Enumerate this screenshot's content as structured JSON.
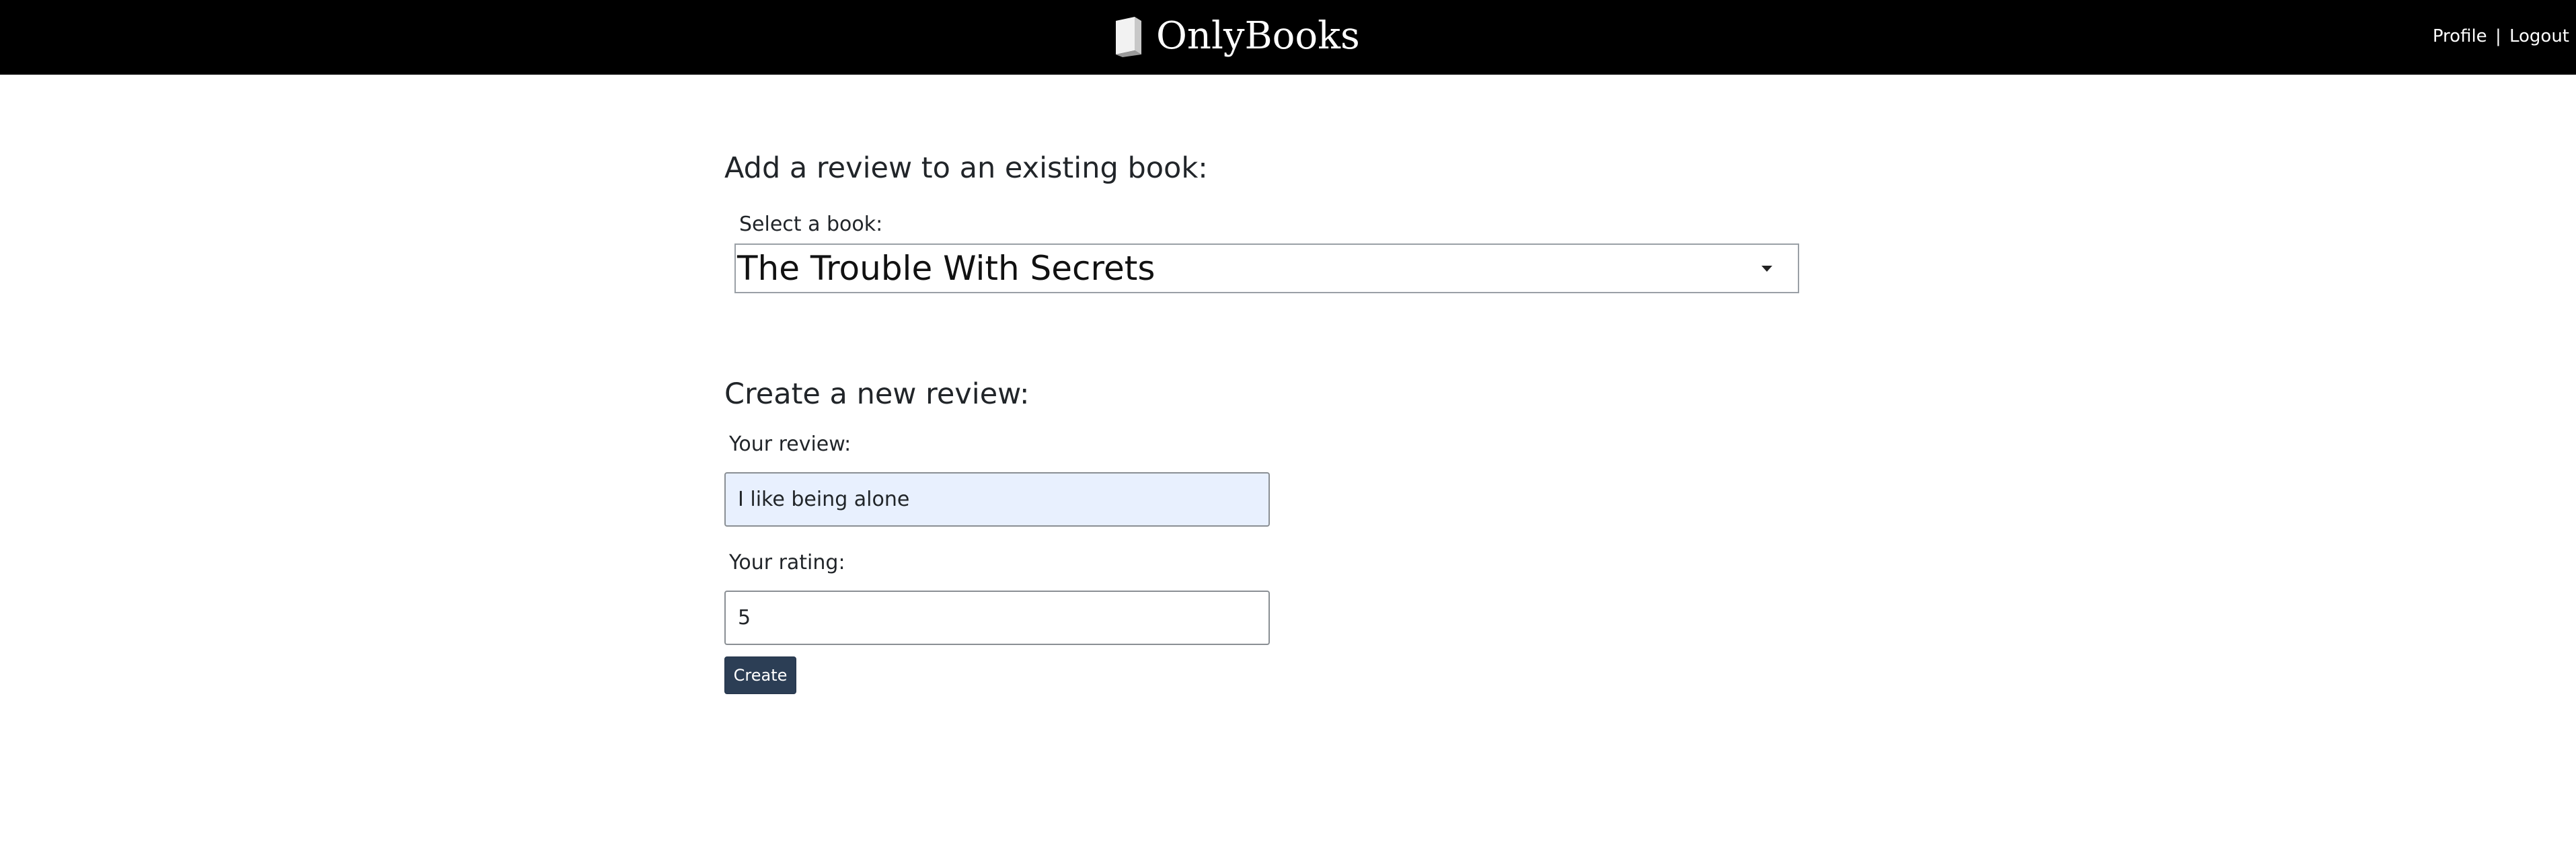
{
  "navbar": {
    "brand": "OnlyBooks",
    "brand_icon": "book-icon",
    "profile_link": "Profile",
    "separator": "|",
    "logout_link": "Logout"
  },
  "existing_section": {
    "title": "Add a review to an existing book:",
    "select_label": "Select a book:",
    "selected_book": "The Trouble With Secrets",
    "dropdown_icon": "caret-down-icon"
  },
  "new_section": {
    "title": "Create a new review:",
    "review_label": "Your review:",
    "review_value": "I like being alone",
    "rating_label": "Your rating:",
    "rating_value": "5",
    "create_button": "Create"
  },
  "colors": {
    "navbar_bg": "#000000",
    "button_bg": "#2c3e55",
    "autofill_bg": "#e8f0fe"
  }
}
